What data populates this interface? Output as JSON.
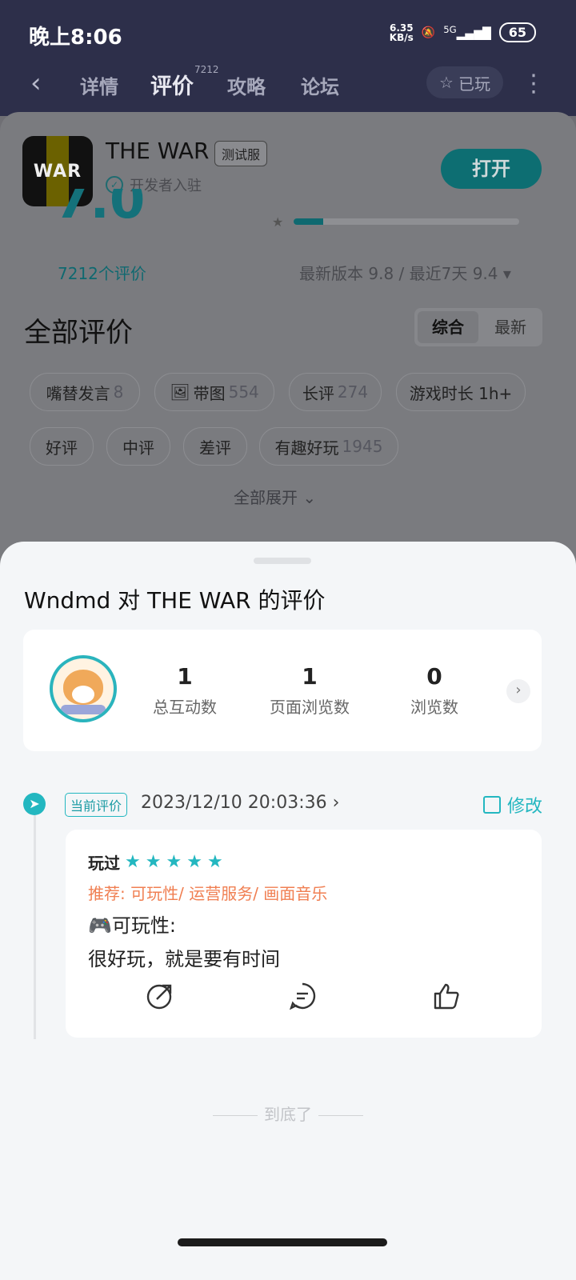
{
  "status_bar": {
    "time": "晚上8:06",
    "net_speed_value": "6.35",
    "net_speed_unit": "KB/s",
    "network": "5G",
    "battery": "65"
  },
  "nav": {
    "tabs": [
      {
        "label": "详情"
      },
      {
        "label": "评价",
        "superscript": "7212"
      },
      {
        "label": "攻略"
      },
      {
        "label": "论坛"
      }
    ],
    "played_button": "已玩"
  },
  "app": {
    "name": "THE WAR",
    "icon_text": "WAR",
    "badge": "测试服",
    "developer_label": "开发者入驻",
    "open_button": "打开",
    "score_partial": "7.0",
    "rating_bar_fraction": 0.13,
    "review_count": "7212个评价",
    "version_score": "最新版本 9.8 / 最近7天 9.4 ▾"
  },
  "reviews_section": {
    "title": "全部评价",
    "sort_options": [
      "综合",
      "最新"
    ],
    "chips": [
      {
        "label": "嘴替发言",
        "count": "8"
      },
      {
        "label": "带图",
        "count": "554"
      },
      {
        "label": "长评",
        "count": "274"
      },
      {
        "label": "游戏时长 1h+",
        "count": ""
      },
      {
        "label": "好评",
        "count": ""
      },
      {
        "label": "中评",
        "count": ""
      },
      {
        "label": "差评",
        "count": ""
      },
      {
        "label": "有趣好玩",
        "count": "1945"
      }
    ],
    "expand_label": "全部展开"
  },
  "sheet": {
    "title": "Wndmd 对 THE WAR 的评价",
    "stats": [
      {
        "value": "1",
        "label": "总互动数"
      },
      {
        "value": "1",
        "label": "页面浏览数"
      },
      {
        "value": "0",
        "label": "浏览数"
      }
    ],
    "review": {
      "current_tag": "当前评价",
      "date": "2023/12/10 20:03:36 ›",
      "edit_label": "修改",
      "played_label": "玩过",
      "stars": 5,
      "recommend": "推荐: 可玩性/ 运营服务/ 画面音乐",
      "heading": "🎮可玩性:",
      "body": "很好玩，就是要有时间"
    },
    "end_text": "到底了"
  },
  "colors": {
    "accent": "#23b7c0",
    "recommend": "#f07f52",
    "header_bg": "#2d2f4a"
  }
}
